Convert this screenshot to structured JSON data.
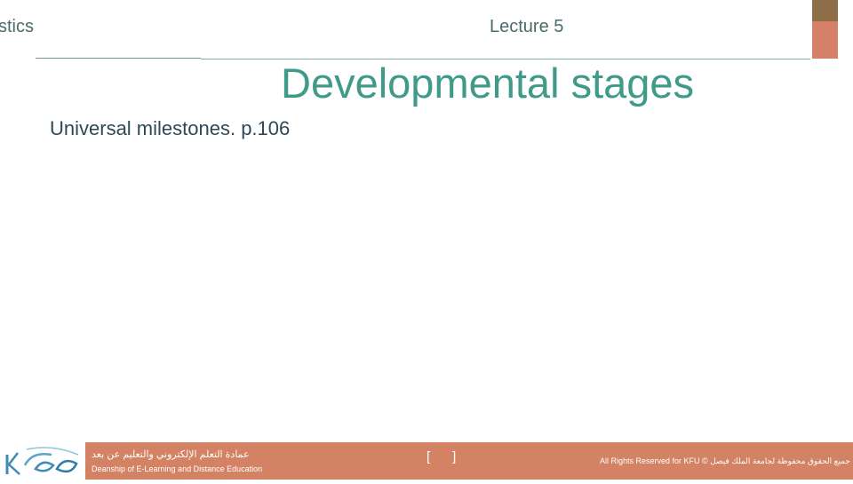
{
  "header": {
    "course_fragment": "stics",
    "lecture": "Lecture 5"
  },
  "slide": {
    "title": "Developmental stages",
    "subtitle": "Universal milestones. p.106"
  },
  "footer": {
    "logo_text": "KFU",
    "deanship_arabic": "عمادة التعلم الإلكتروني والتعليم عن بعد",
    "deanship_english": "Deanship of E-Learning and Distance Education",
    "page_number": "[      ]",
    "rights": "All Rights Reserved for KFU © جميع الحقوق محفوظة لجامعة الملك فيصل"
  },
  "colors": {
    "title": "#3f9a8a",
    "footer_bar": "#d48264",
    "corner_brown": "#8e6e46",
    "corner_salmon": "#d6806a"
  }
}
